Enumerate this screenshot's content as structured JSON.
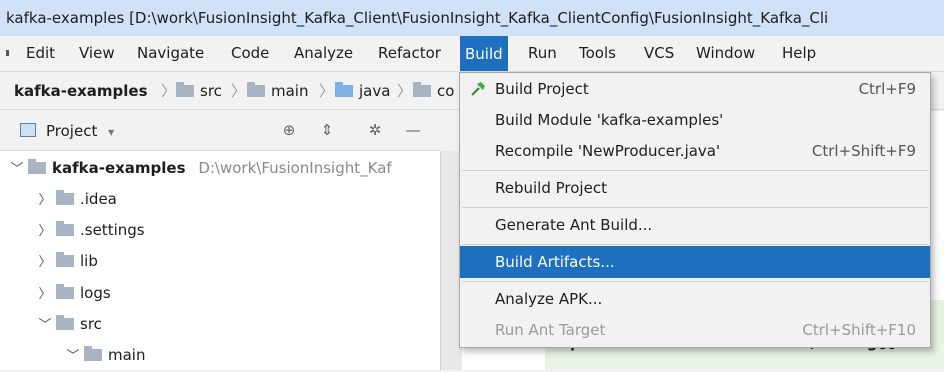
{
  "window": {
    "title": "kafka-examples [D:\\work\\FusionInsight_Kafka_Client\\FusionInsight_Kafka_ClientConfig\\FusionInsight_Kafka_Cli"
  },
  "menubar": {
    "items": [
      "Edit",
      "View",
      "Navigate",
      "Code",
      "Analyze",
      "Refactor",
      "Build",
      "Run",
      "Tools",
      "VCS",
      "Window",
      "Help"
    ],
    "active": "Build"
  },
  "breadcrumb": {
    "items": [
      "kafka-examples",
      "src",
      "main",
      "java",
      "co"
    ]
  },
  "project_panel": {
    "title": "Project",
    "dropdown_glyph": "▾"
  },
  "tree": {
    "root": {
      "name": "kafka-examples",
      "path": "D:\\work\\FusionInsight_Kaf"
    },
    "children": [
      ".idea",
      ".settings",
      "lib",
      "logs",
      "src",
      "main"
    ]
  },
  "build_menu": {
    "items": [
      {
        "label": "Build Project",
        "shortcut": "Ctrl+F9",
        "icon": "hammer-icon"
      },
      {
        "label": "Build Module 'kafka-examples'",
        "shortcut": ""
      },
      {
        "label": "Recompile 'NewProducer.java'",
        "shortcut": "Ctrl+Shift+F9"
      },
      {
        "label": "Rebuild Project",
        "shortcut": ""
      },
      {
        "label": "Generate Ant Build...",
        "shortcut": ""
      },
      {
        "label": "Build Artifacts...",
        "shortcut": "",
        "highlighted": true
      },
      {
        "label": "Analyze APK...",
        "shortcut": ""
      },
      {
        "label": "Run Ant Target",
        "shortcut": "Ctrl+Shift+F10",
        "disabled": true
      }
    ]
  },
  "editor": {
    "visible_code": "public static void main(String[] ar"
  },
  "colors": {
    "accent": "#1e6fbf",
    "titlebar": "#cfe2f7",
    "editor_green": "#e6f5e1"
  }
}
